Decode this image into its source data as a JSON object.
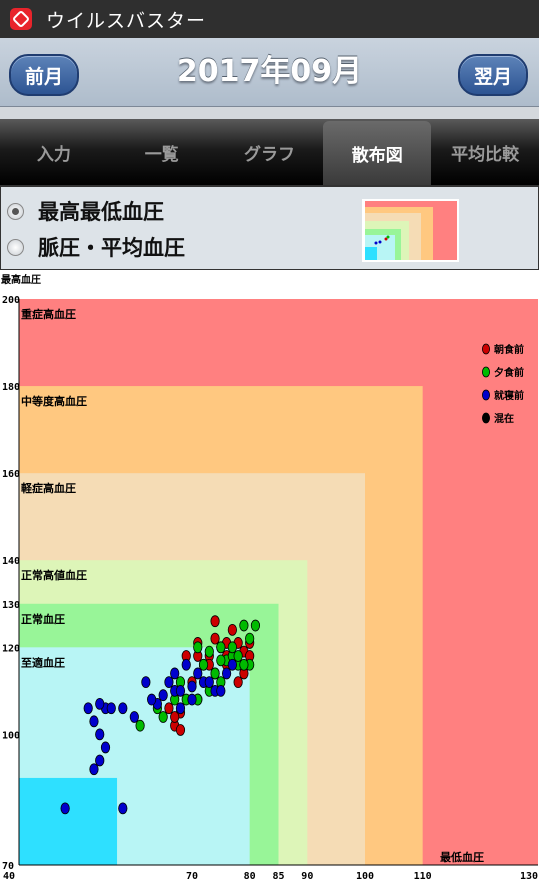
{
  "app": {
    "title": "ウイルスバスター",
    "icon": "virusbuster-app-icon"
  },
  "month_nav": {
    "prev_label": "前月",
    "title": "2017年09月",
    "next_label": "翌月"
  },
  "tabs": [
    {
      "label": "入力",
      "active": false
    },
    {
      "label": "一覧",
      "active": false
    },
    {
      "label": "グラフ",
      "active": false
    },
    {
      "label": "散布図",
      "active": true
    },
    {
      "label": "平均比較",
      "active": false
    }
  ],
  "options": [
    {
      "label": "最高最低血圧",
      "selected": true
    },
    {
      "label": "脈圧・平均血圧",
      "selected": false
    }
  ],
  "colors": {
    "zone_severe": "#ff8080",
    "zone_moderate": "#ffc880",
    "zone_mild": "#f5dcb5",
    "zone_high_normal": "#ddf5b8",
    "zone_normal": "#98f598",
    "zone_optimal": "#b8f5f5",
    "zone_low": "#2ee0ff",
    "morning": "#cc0000",
    "evening": "#00bb00",
    "bedtime": "#0000cc",
    "mixed": "#000000"
  },
  "chart_data": {
    "type": "scatter",
    "ylabel": "最高血圧",
    "xlabel": "最低血圧",
    "xlim": [
      40,
      130
    ],
    "ylim": [
      70,
      200
    ],
    "x_ticks": [
      40,
      70,
      80,
      85,
      90,
      100,
      110,
      130
    ],
    "y_ticks": [
      70,
      100,
      120,
      130,
      140,
      160,
      180,
      200
    ],
    "zones": [
      {
        "label": "重症高血圧",
        "x_max": 130,
        "y_max": 200,
        "color_key": "zone_severe"
      },
      {
        "label": "中等度高血圧",
        "x_max": 110,
        "y_max": 180,
        "color_key": "zone_moderate"
      },
      {
        "label": "軽症高血圧",
        "x_max": 100,
        "y_max": 160,
        "color_key": "zone_mild"
      },
      {
        "label": "正常高値血圧",
        "x_max": 90,
        "y_max": 140,
        "color_key": "zone_high_normal"
      },
      {
        "label": "正常血圧",
        "x_max": 85,
        "y_max": 130,
        "color_key": "zone_normal"
      },
      {
        "label": "至適血圧",
        "x_max": 80,
        "y_max": 120,
        "color_key": "zone_optimal"
      },
      {
        "label": "",
        "x_max": 57,
        "y_max": 90,
        "color_key": "zone_low"
      }
    ],
    "legend_position": "top-right",
    "series": [
      {
        "name": "朝食前",
        "color_key": "morning",
        "points": [
          [
            71,
            121
          ],
          [
            71,
            118
          ],
          [
            72,
            116
          ],
          [
            73,
            118
          ],
          [
            74,
            122
          ],
          [
            75,
            120
          ],
          [
            76,
            118
          ],
          [
            77,
            124
          ],
          [
            78,
            121
          ],
          [
            79,
            119
          ],
          [
            80,
            121
          ],
          [
            74,
            114
          ],
          [
            76,
            116
          ],
          [
            79,
            114
          ],
          [
            80,
            118
          ],
          [
            78,
            112
          ],
          [
            71,
            108
          ],
          [
            68,
            105
          ],
          [
            67,
            102
          ],
          [
            68,
            101
          ],
          [
            66,
            106
          ],
          [
            67,
            104
          ],
          [
            73,
            116
          ],
          [
            76,
            121
          ],
          [
            74,
            126
          ],
          [
            69,
            118
          ],
          [
            70,
            112
          ]
        ]
      },
      {
        "name": "夕食前",
        "color_key": "evening",
        "points": [
          [
            75,
            120
          ],
          [
            76,
            117
          ],
          [
            79,
            125
          ],
          [
            81,
            125
          ],
          [
            80,
            122
          ],
          [
            77,
            118
          ],
          [
            78,
            116
          ],
          [
            80,
            116
          ],
          [
            72,
            116
          ],
          [
            74,
            114
          ],
          [
            71,
            120
          ],
          [
            73,
            119
          ],
          [
            75,
            117
          ],
          [
            77,
            120
          ],
          [
            75,
            112
          ],
          [
            73,
            110
          ],
          [
            71,
            108
          ],
          [
            69,
            108
          ],
          [
            67,
            108
          ],
          [
            61,
            102
          ],
          [
            64,
            106
          ],
          [
            68,
            112
          ],
          [
            65,
            104
          ],
          [
            78,
            118
          ],
          [
            79,
            116
          ]
        ]
      },
      {
        "name": "就寝前",
        "color_key": "bedtime",
        "points": [
          [
            48,
            83
          ],
          [
            58,
            83
          ],
          [
            53,
            92
          ],
          [
            54,
            94
          ],
          [
            55,
            97
          ],
          [
            54,
            100
          ],
          [
            53,
            103
          ],
          [
            55,
            106
          ],
          [
            52,
            106
          ],
          [
            54,
            107
          ],
          [
            56,
            106
          ],
          [
            58,
            106
          ],
          [
            60,
            104
          ],
          [
            64,
            107
          ],
          [
            65,
            109
          ],
          [
            67,
            110
          ],
          [
            68,
            106
          ],
          [
            68,
            110
          ],
          [
            70,
            111
          ],
          [
            72,
            112
          ],
          [
            74,
            110
          ],
          [
            76,
            114
          ],
          [
            77,
            116
          ],
          [
            70,
            108
          ],
          [
            63,
            108
          ],
          [
            66,
            112
          ],
          [
            62,
            112
          ],
          [
            67,
            114
          ],
          [
            69,
            116
          ],
          [
            71,
            114
          ],
          [
            73,
            112
          ],
          [
            75,
            110
          ]
        ]
      },
      {
        "name": "混在",
        "color_key": "mixed",
        "points": []
      }
    ]
  }
}
